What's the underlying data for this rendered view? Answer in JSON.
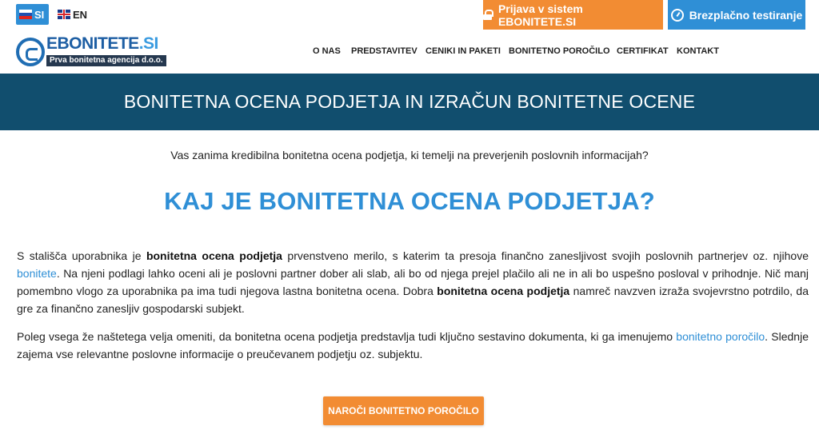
{
  "colors": {
    "accent_blue": "#2f8fd6",
    "accent_orange": "#f28c33",
    "banner_bg": "#114e6e",
    "logo_dark": "#1d5ea3"
  },
  "topbar": {
    "lang_si": "SI",
    "lang_en": "EN",
    "login_label": "Prijava v sistem EBONITETE.SI",
    "login_icon": "lock-icon",
    "test_label": "Brezplačno testiranje",
    "test_icon": "gauge-icon"
  },
  "logo": {
    "name": "EBONITETE",
    "tld": ".SI",
    "tagline": "Prva bonitetna agencija d.o.o."
  },
  "nav": {
    "items": [
      {
        "label": "O NAS"
      },
      {
        "label": "PREDSTAVITEV"
      },
      {
        "label": "CENIKI IN PAKETI"
      },
      {
        "label": "BONITETNO POROČILO"
      },
      {
        "label": "CERTIFIKAT"
      },
      {
        "label": "KONTAKT"
      }
    ]
  },
  "banner": {
    "title": "BONITETNA OCENA PODJETJA IN IZRAČUN BONITETNE OCENE"
  },
  "content": {
    "intro": "Vas zanima kredibilna bonitetna ocena podjetja, ki temelji na preverjenih poslovnih informacijah?",
    "heading": "KAJ JE BONITETNA OCENA PODJETJA?",
    "p1_a": "S stališča uporabnika je ",
    "p1_b": "bonitetna ocena podjetja",
    "p1_c": " prvenstveno merilo, s katerim ta presoja finančno zanesljivost svojih poslovnih partnerjev oz. njihove ",
    "p1_link": "bonitete",
    "p1_d": ". Na njeni podlagi lahko oceni ali je poslovni partner dober ali slab, ali bo od njega prejel plačilo ali ne in ali bo uspešno posloval v prihodnje. Nič manj pomembno vlogo za uporabnika pa ima tudi njegova lastna bonitetna ocena. Dobra ",
    "p1_e": "bonitetna ocena podjetja",
    "p1_f": " namreč navzven izraža svojevrstno potrdilo, da gre za finančno zanesljiv gospodarski subjekt.",
    "p2_a": "Poleg vsega že naštetega velja omeniti, da bonitetna ocena podjetja predstavlja tudi ključno sestavino dokumenta, ki ga imenujemo ",
    "p2_link": "bonitetno poročilo",
    "p2_b": ". Slednje zajema vse relevantne poslovne informacije o preučevanem podjetju oz. subjektu.",
    "cta_label": "NAROČI BONITETNO POROČILO"
  }
}
